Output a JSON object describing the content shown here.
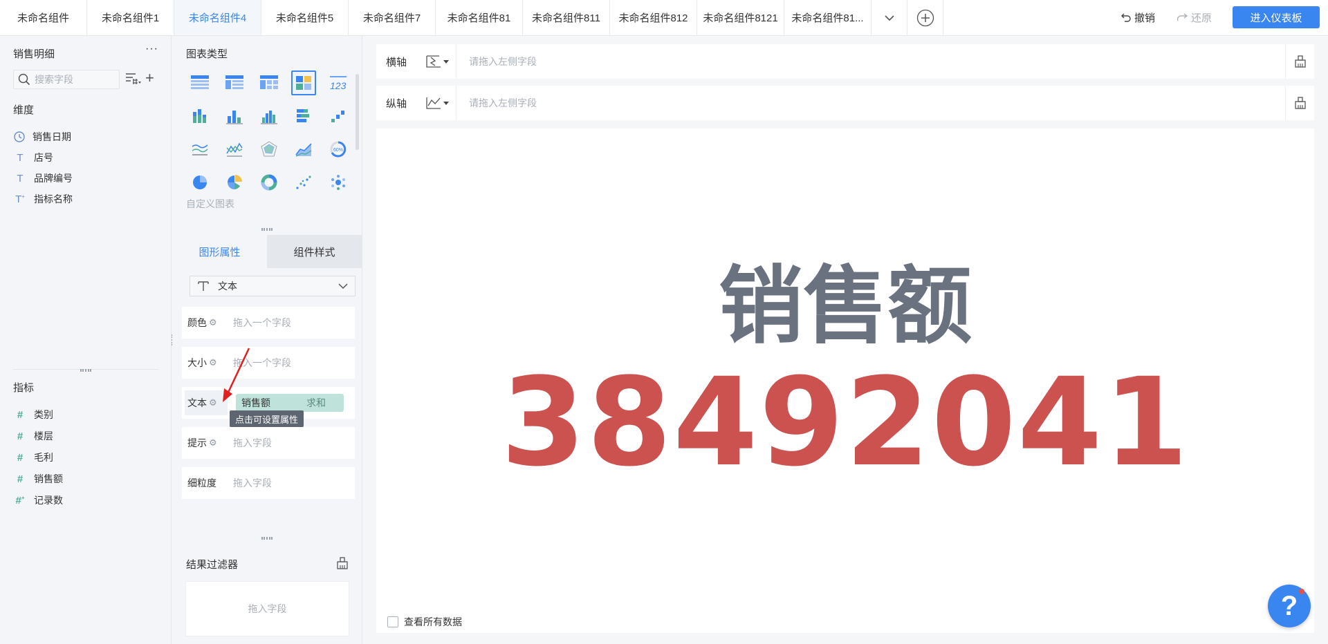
{
  "top_tabs": [
    "未命名组件",
    "未命名组件1",
    "未命名组件4",
    "未命名组件5",
    "未命名组件7",
    "未命名组件81",
    "未命名组件811",
    "未命名组件812",
    "未命名组件8121",
    "未命名组件81..."
  ],
  "active_tab": "未命名组件4",
  "toolbar": {
    "undo_label": "撤销",
    "redo_label": "还原",
    "enter_dashboard_label": "进入仪表板"
  },
  "field_panel": {
    "title": "销售明细",
    "search_placeholder": "搜索字段",
    "dimensions_label": "维度",
    "dimensions": [
      {
        "icon": "clock-icon",
        "label": "销售日期"
      },
      {
        "icon": "text-icon",
        "label": "店号"
      },
      {
        "icon": "text-icon",
        "label": "品牌编号"
      },
      {
        "icon": "text-calc-icon",
        "label": "指标名称"
      }
    ],
    "measures_label": "指标",
    "measures": [
      {
        "icon": "hash-icon",
        "label": "类别"
      },
      {
        "icon": "hash-icon",
        "label": "楼层"
      },
      {
        "icon": "hash-icon",
        "label": "毛利"
      },
      {
        "icon": "hash-icon",
        "label": "销售额"
      },
      {
        "icon": "hash-calc-icon",
        "label": "记录数"
      }
    ]
  },
  "config_panel": {
    "chart_types_title": "图表类型",
    "custom_chart_label": "自定义图表",
    "tabs": {
      "graphic": "图形属性",
      "style": "组件样式"
    },
    "mark_type": "文本",
    "props": {
      "color_label": "颜色",
      "color_drop": "拖入一个字段",
      "size_label": "大小",
      "size_drop": "拖入一个字段",
      "text_label": "文本",
      "text_field": "销售额",
      "text_agg": "求和",
      "tip_label": "提示",
      "tip_drop": "拖入字段",
      "granularity_label": "细粒度",
      "granularity_drop": "拖入字段"
    },
    "tooltip": "点击可设置属性",
    "filter_title": "结果过滤器",
    "filter_drop": "拖入字段"
  },
  "axes": {
    "x_label": "横轴",
    "x_placeholder": "请拖入左侧字段",
    "y_label": "纵轴",
    "y_placeholder": "请拖入左侧字段"
  },
  "kpi": {
    "title": "销售额",
    "value": "38492041"
  },
  "view_all_label": "查看所有数据",
  "help_label": "?",
  "colors": {
    "accent": "#3a86f0",
    "kpi_value": "#cc5250",
    "kpi_title": "#6a7280",
    "pill": "#bfe3da"
  }
}
